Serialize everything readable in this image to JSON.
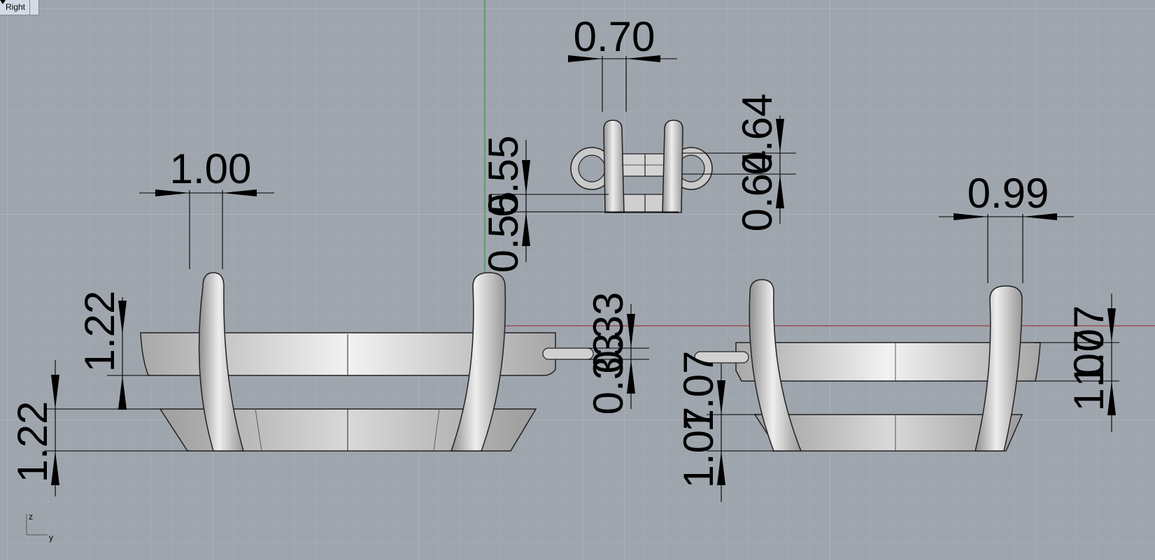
{
  "viewport": {
    "name": "Right",
    "menu_icon": "triangle-down-icon"
  },
  "dimensions": {
    "top_width": "0.70",
    "top_right_upper": "0.64",
    "top_right_lower": "0.64",
    "top_left_upper": "0.55",
    "top_left_lower": "0.55",
    "left_width": "1.00",
    "left_upper": "1.22",
    "left_lower": "1.22",
    "middle_upper": "0.33",
    "middle_lower": "0.33",
    "right_width": "0.99",
    "right_upper": "1.07",
    "right_lower": "1.07",
    "right_left_upper": "1.07",
    "right_left_lower": "1.07"
  },
  "axis_indicator": {
    "vertical": "z",
    "horizontal": "y"
  },
  "colors": {
    "background": "#9ea5ad",
    "grid": "#a6adb5",
    "grid_major": "#b4bac1",
    "world_x_axis": "#9a3f3f",
    "world_y_axis": "#3c9c3c",
    "object_fill": "#c7c7c7",
    "dimension_ink": "#000000"
  }
}
